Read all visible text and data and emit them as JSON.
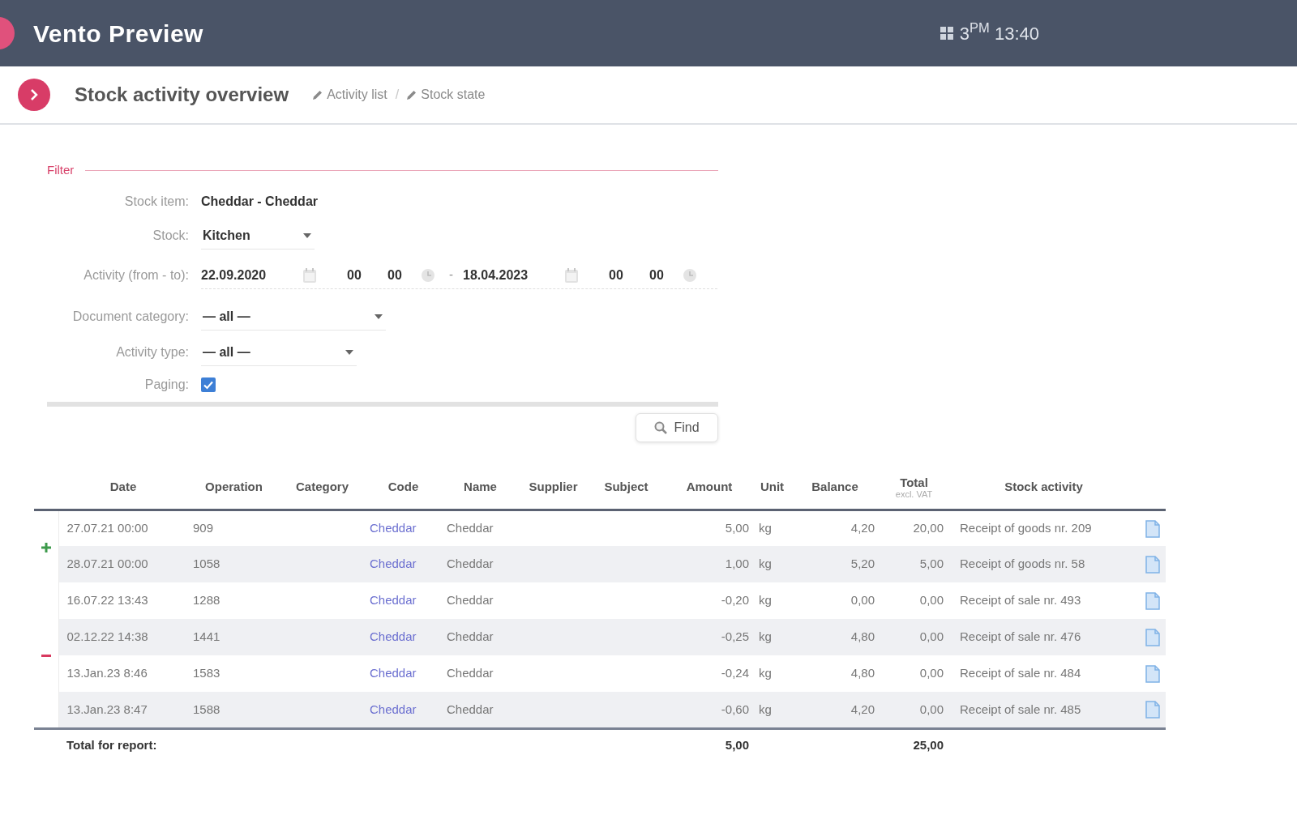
{
  "app": {
    "title": "Vento Preview",
    "clock": "3$^{PM}$ 13:40"
  },
  "page": {
    "title": "Stock activity overview",
    "links": [
      "Activity list",
      "Stock state"
    ],
    "separator": "/"
  },
  "filter": {
    "legend": "Filter",
    "stock_item": {
      "label": "Stock item:",
      "value": "Cheddar - Cheddar"
    },
    "stock": {
      "label": "Stock:",
      "value": "Kitchen"
    },
    "activity": {
      "label": "Activity (from - to):",
      "from": {
        "date": "22.09.2020",
        "hour": "00",
        "minute": "00"
      },
      "separator": "-",
      "to": {
        "date": "18.04.2023",
        "hour": "00",
        "minute": "00"
      }
    },
    "document_category": {
      "label": "Document category:",
      "value": "— all —"
    },
    "activity_type": {
      "label": "Activity type:",
      "value": "— all —"
    },
    "paging": {
      "label": "Paging:",
      "checked": true
    },
    "find_button": "Find"
  },
  "table": {
    "columns": [
      {
        "label": "Date"
      },
      {
        "label": "Operation"
      },
      {
        "label": "Category"
      },
      {
        "label": "Code"
      },
      {
        "label": "Name"
      },
      {
        "label": "Supplier"
      },
      {
        "label": "Subject"
      },
      {
        "label": "Amount"
      },
      {
        "label": "Unit"
      },
      {
        "label": "Balance"
      },
      {
        "label": "Total",
        "sublabel": "excl. VAT"
      },
      {
        "label": "Stock activity"
      }
    ],
    "groups": [
      {
        "kind": "incoming",
        "rows": [
          {
            "date": "27.07.21 00:00",
            "operation": "909",
            "code": "Cheddar",
            "name": "Cheddar",
            "amount": "5,00",
            "unit": "kg",
            "balance": "4,20",
            "total": "20,00",
            "stock_activity": "Receipt of goods nr. 209"
          },
          {
            "date": "28.07.21 00:00",
            "operation": "1058",
            "code": "Cheddar",
            "name": "Cheddar",
            "amount": "1,00",
            "unit": "kg",
            "balance": "5,20",
            "total": "5,00",
            "stock_activity": "Receipt of goods nr. 58"
          }
        ]
      },
      {
        "kind": "outgoing",
        "rows": [
          {
            "date": "16.07.22 13:43",
            "operation": "1288",
            "code": "Cheddar",
            "name": "Cheddar",
            "amount": "-0,20",
            "unit": "kg",
            "balance": "0,00",
            "total": "0,00",
            "stock_activity": "Receipt of sale nr. 493"
          },
          {
            "date": "02.12.22 14:38",
            "operation": "1441",
            "code": "Cheddar",
            "name": "Cheddar",
            "amount": "-0,25",
            "unit": "kg",
            "balance": "4,80",
            "total": "0,00",
            "stock_activity": "Receipt of sale nr. 476"
          },
          {
            "date": "13.Jan.23 8:46",
            "operation": "1583",
            "code": "Cheddar",
            "name": "Cheddar",
            "amount": "-0,24",
            "unit": "kg",
            "balance": "4,80",
            "total": "0,00",
            "stock_activity": "Receipt of sale nr. 484"
          },
          {
            "date": "13.Jan.23 8:47",
            "operation": "1588",
            "code": "Cheddar",
            "name": "Cheddar",
            "amount": "-0,60",
            "unit": "kg",
            "balance": "4,20",
            "total": "0,00",
            "stock_activity": "Receipt of sale nr. 485"
          }
        ]
      }
    ],
    "total_row": {
      "label": "Total for report:",
      "amount": "5,00",
      "total": "25,00"
    }
  }
}
